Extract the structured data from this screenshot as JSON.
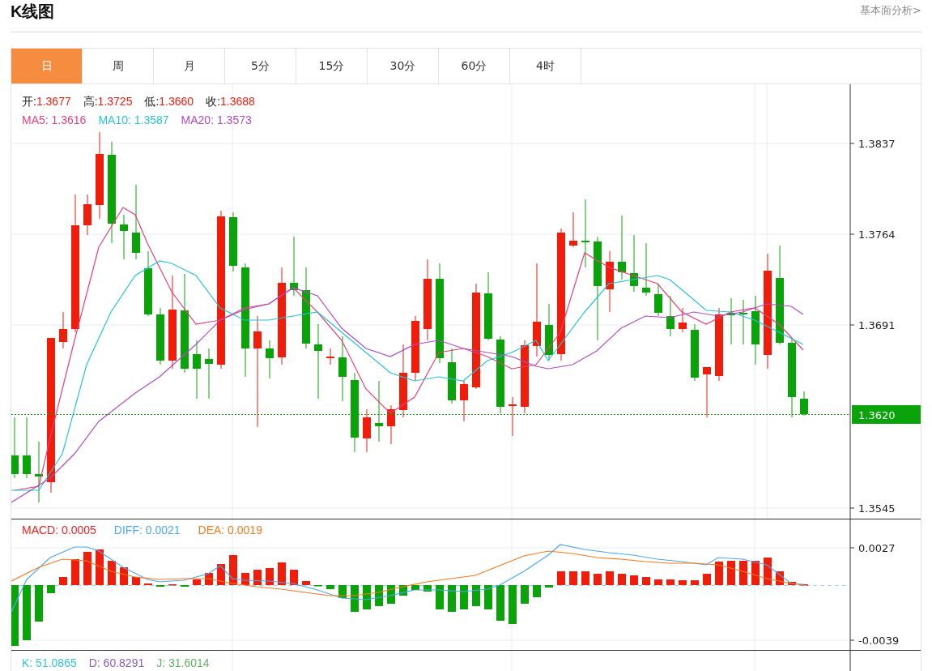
{
  "header": {
    "title": "K线图",
    "link": "基本面分析>"
  },
  "tabs": [
    {
      "label": "日",
      "selected": true
    },
    {
      "label": "周",
      "selected": false
    },
    {
      "label": "月",
      "selected": false
    },
    {
      "label": "5分",
      "selected": false
    },
    {
      "label": "15分",
      "selected": false
    },
    {
      "label": "30分",
      "selected": false
    },
    {
      "label": "60分",
      "selected": false
    },
    {
      "label": "4时",
      "selected": false
    }
  ],
  "price_legend": [
    {
      "label": "开:",
      "value": "1.3677"
    },
    {
      "label": "高:",
      "value": "1.3725"
    },
    {
      "label": "低:",
      "value": "1.3660"
    },
    {
      "label": "收:",
      "value": "1.3688"
    }
  ],
  "ma_legend": [
    {
      "label": "MA5:",
      "value": "1.3616",
      "color": "#e8407a"
    },
    {
      "label": "MA10:",
      "value": "1.3587",
      "color": "#25c4d8"
    },
    {
      "label": "MA20:",
      "value": "1.3573",
      "color": "#b04ac6"
    }
  ],
  "price_axis": {
    "ticks": [
      "1.3837",
      "1.3764",
      "1.3691",
      "1.3545"
    ],
    "last_price": "1.3620"
  },
  "macd_legend": [
    {
      "label": "MACD:",
      "value": "0.0005",
      "color": "#ee2222"
    },
    {
      "label": "DIFF:",
      "value": "0.0021",
      "color": "#4aa9f0"
    },
    {
      "label": "DEA:",
      "value": "0.0019",
      "color": "#f47b1e"
    }
  ],
  "macd_axis": {
    "ticks": [
      "0.0027",
      "-0.0039"
    ]
  },
  "kdj_legend": [
    {
      "label": "K:",
      "value": "51.0865",
      "color": "#2fc6d6"
    },
    {
      "label": "D:",
      "value": "60.8291",
      "color": "#8a5cc4"
    },
    {
      "label": "J:",
      "value": "31.6014",
      "color": "#5cb85c"
    }
  ]
}
